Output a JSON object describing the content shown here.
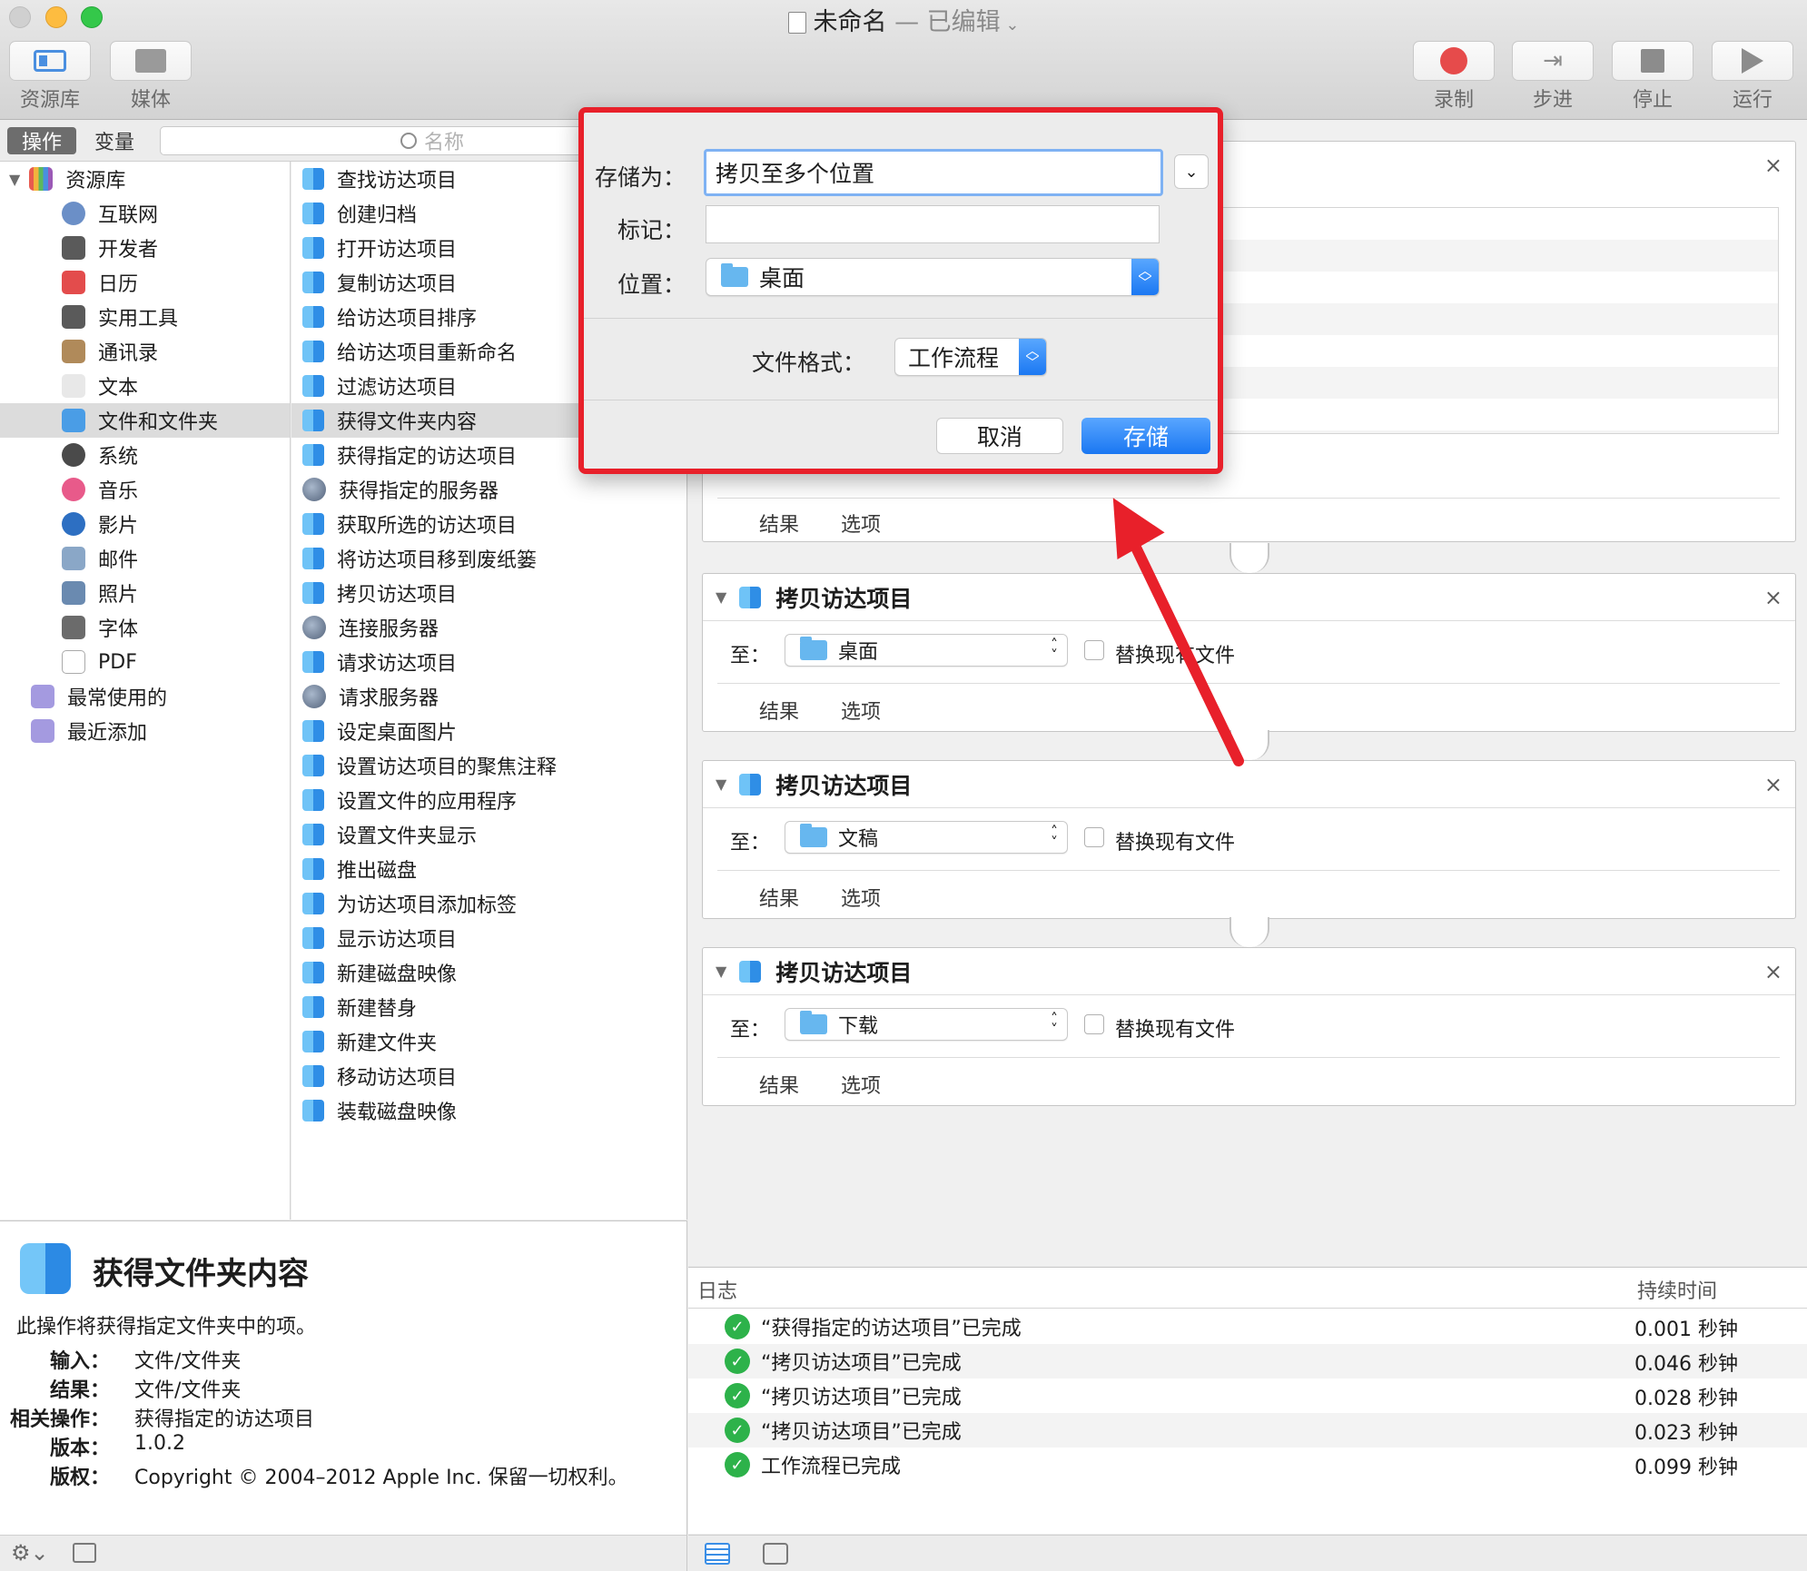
{
  "window": {
    "title": "未命名",
    "title_suffix": "— 已编辑"
  },
  "toolbar": {
    "left": [
      {
        "label": "资源库",
        "icon": "library-icon"
      },
      {
        "label": "媒体",
        "icon": "media-icon"
      }
    ],
    "right": [
      {
        "label": "录制",
        "icon": "record-icon"
      },
      {
        "label": "步进",
        "icon": "step-icon"
      },
      {
        "label": "停止",
        "icon": "stop-icon"
      },
      {
        "label": "运行",
        "icon": "run-icon"
      }
    ]
  },
  "subheader": {
    "tab_actions": "操作",
    "tab_variables": "变量",
    "search_placeholder": "名称"
  },
  "library": {
    "root": "资源库",
    "items": [
      "互联网",
      "开发者",
      "日历",
      "实用工具",
      "通讯录",
      "文本",
      "文件和文件夹",
      "系统",
      "音乐",
      "影片",
      "邮件",
      "照片",
      "字体",
      "PDF"
    ],
    "selected": "文件和文件夹",
    "smart": [
      "最常使用的",
      "最近添加"
    ]
  },
  "actions": {
    "items": [
      "查找访达项目",
      "创建归档",
      "打开访达项目",
      "复制访达项目",
      "给访达项目排序",
      "给访达项目重新命名",
      "过滤访达项目",
      "获得文件夹内容",
      "获得指定的访达项目",
      "获得指定的服务器",
      "获取所选的访达项目",
      "将访达项目移到废纸篓",
      "拷贝访达项目",
      "连接服务器",
      "请求访达项目",
      "请求服务器",
      "设定桌面图片",
      "设置访达项目的聚焦注释",
      "设置文件的应用程序",
      "设置文件夹显示",
      "推出磁盘",
      "为访达项目添加标签",
      "显示访达项目",
      "新建磁盘映像",
      "新建替身",
      "新建文件夹",
      "移动访达项目",
      "装载磁盘映像"
    ],
    "selected": "获得文件夹内容"
  },
  "description": {
    "title": "获得文件夹内容",
    "summary": "此操作将获得指定文件夹中的项。",
    "fields": [
      {
        "label": "输入：",
        "value": "文件/文件夹"
      },
      {
        "label": "结果：",
        "value": "文件/文件夹"
      },
      {
        "label": "相关操作：",
        "value": "获得指定的访达项目"
      },
      {
        "label": "版本：",
        "value": "1.0.2"
      },
      {
        "label": "版权：",
        "value": "Copyright © 2004–2012 Apple Inc. 保留一切权利。"
      }
    ]
  },
  "workflow": {
    "cards": [
      {
        "title": "拷贝访达项目",
        "to_label": "至：",
        "destination": "桌面",
        "replace_label": "替换现有文件",
        "tab_results": "结果",
        "tab_options": "选项"
      },
      {
        "title": "拷贝访达项目",
        "to_label": "至：",
        "destination": "文稿",
        "replace_label": "替换现有文件",
        "tab_results": "结果",
        "tab_options": "选项"
      },
      {
        "title": "拷贝访达项目",
        "to_label": "至：",
        "destination": "下载",
        "replace_label": "替换现有文件",
        "tab_results": "结果",
        "tab_options": "选项"
      }
    ],
    "top_card_tabs": {
      "results": "结果",
      "options": "选项"
    }
  },
  "log": {
    "col_log": "日志",
    "col_duration": "持续时间",
    "rows": [
      {
        "text": "“获得指定的访达项目”已完成",
        "duration": "0.001 秒钟"
      },
      {
        "text": "“拷贝访达项目”已完成",
        "duration": "0.046 秒钟"
      },
      {
        "text": "“拷贝访达项目”已完成",
        "duration": "0.028 秒钟"
      },
      {
        "text": "“拷贝访达项目”已完成",
        "duration": "0.023 秒钟"
      },
      {
        "text": "工作流程已完成",
        "duration": "0.099 秒钟"
      }
    ]
  },
  "save_dialog": {
    "save_as_label": "存储为：",
    "save_as_value": "拷贝至多个位置",
    "tags_label": "标记：",
    "location_label": "位置：",
    "location_value": "桌面",
    "format_label": "文件格式：",
    "format_value": "工作流程",
    "cancel": "取消",
    "save": "存储"
  },
  "colors": {
    "highlight_border": "#e8202a",
    "arrow": "#e8202a",
    "primary_button": "#1a77f2",
    "success": "#2db24a"
  }
}
